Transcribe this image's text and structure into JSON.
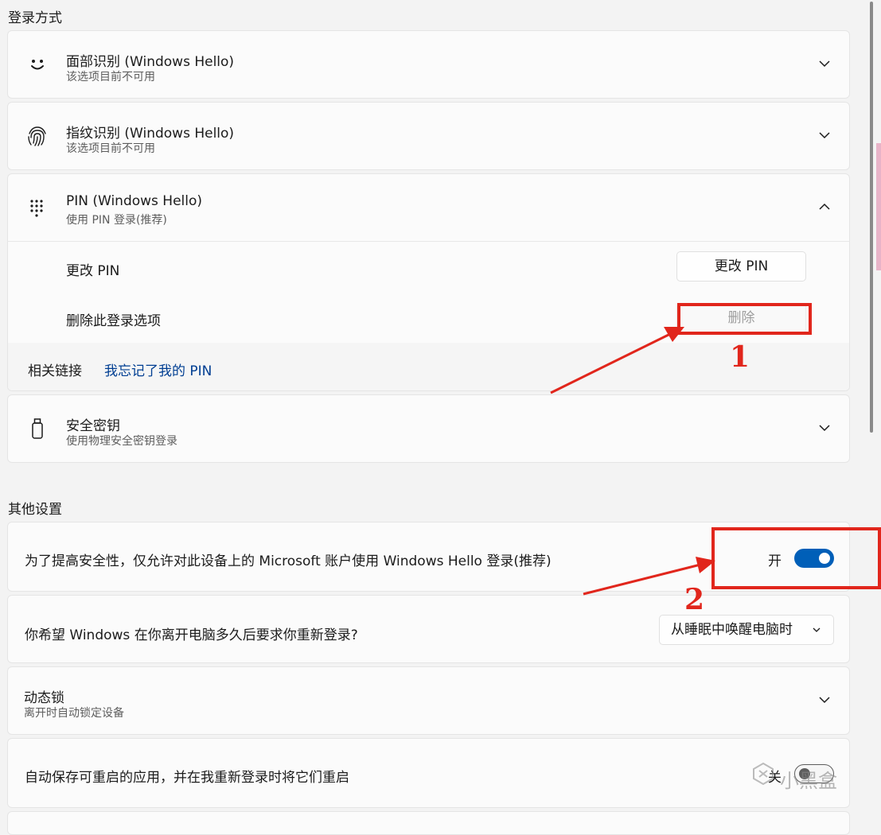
{
  "sections": {
    "sign_in_title": "登录方式",
    "other_title": "其他设置"
  },
  "face": {
    "title": "面部识别 (Windows Hello)",
    "subtitle": "该选项目前不可用",
    "icon": "smiley-face-icon"
  },
  "fingerprint": {
    "title": "指纹识别 (Windows Hello)",
    "subtitle": "该选项目前不可用",
    "icon": "fingerprint-icon"
  },
  "pin": {
    "title": "PIN (Windows Hello)",
    "subtitle": "使用 PIN 登录(推荐)",
    "icon": "keypad-icon",
    "change_label": "更改 PIN",
    "change_button": "更改 PIN",
    "remove_label": "删除此登录选项",
    "remove_button": "删除",
    "related_label": "相关链接",
    "forgot_link": "我忘记了我的 PIN"
  },
  "security_key": {
    "title": "安全密钥",
    "subtitle": "使用物理安全密钥登录",
    "icon": "usb-key-icon"
  },
  "hello_only": {
    "label": "为了提高安全性，仅允许对此设备上的 Microsoft 账户使用 Windows Hello 登录(推荐)",
    "state_text": "开",
    "on": true
  },
  "require_signin": {
    "label": "你希望 Windows 在你离开电脑多久后要求你重新登录?",
    "selected": "从睡眠中唤醒电脑时"
  },
  "dynamic_lock": {
    "title": "动态锁",
    "subtitle": "离开时自动锁定设备"
  },
  "restart_apps": {
    "label": "自动保存可重启的应用，并在我重新登录时将它们重启",
    "state_text": "关",
    "on": false
  },
  "annotations": {
    "marker_1": "1",
    "marker_2": "2",
    "color": "#e1261c"
  },
  "watermark": "小黑盒",
  "colors": {
    "accent": "#005fb8",
    "link": "#003e92"
  }
}
